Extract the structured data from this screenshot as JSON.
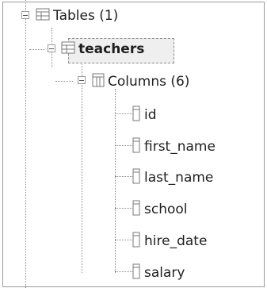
{
  "tree": {
    "tables": {
      "label": "Tables (1)",
      "icon": "table-icon"
    },
    "table": {
      "label": "teachers",
      "icon": "table-icon",
      "selected": true
    },
    "columns": {
      "label": "Columns (6)",
      "icon": "columns-icon"
    },
    "column_items": [
      {
        "label": "id",
        "icon": "column-icon"
      },
      {
        "label": "first_name",
        "icon": "column-icon"
      },
      {
        "label": "last_name",
        "icon": "column-icon"
      },
      {
        "label": "school",
        "icon": "column-icon"
      },
      {
        "label": "hire_date",
        "icon": "column-icon"
      },
      {
        "label": "salary",
        "icon": "column-icon"
      }
    ]
  },
  "colors": {
    "line": "#8a8a8a",
    "selection_bg": "#efefef",
    "selection_border": "#8f8f8f"
  }
}
